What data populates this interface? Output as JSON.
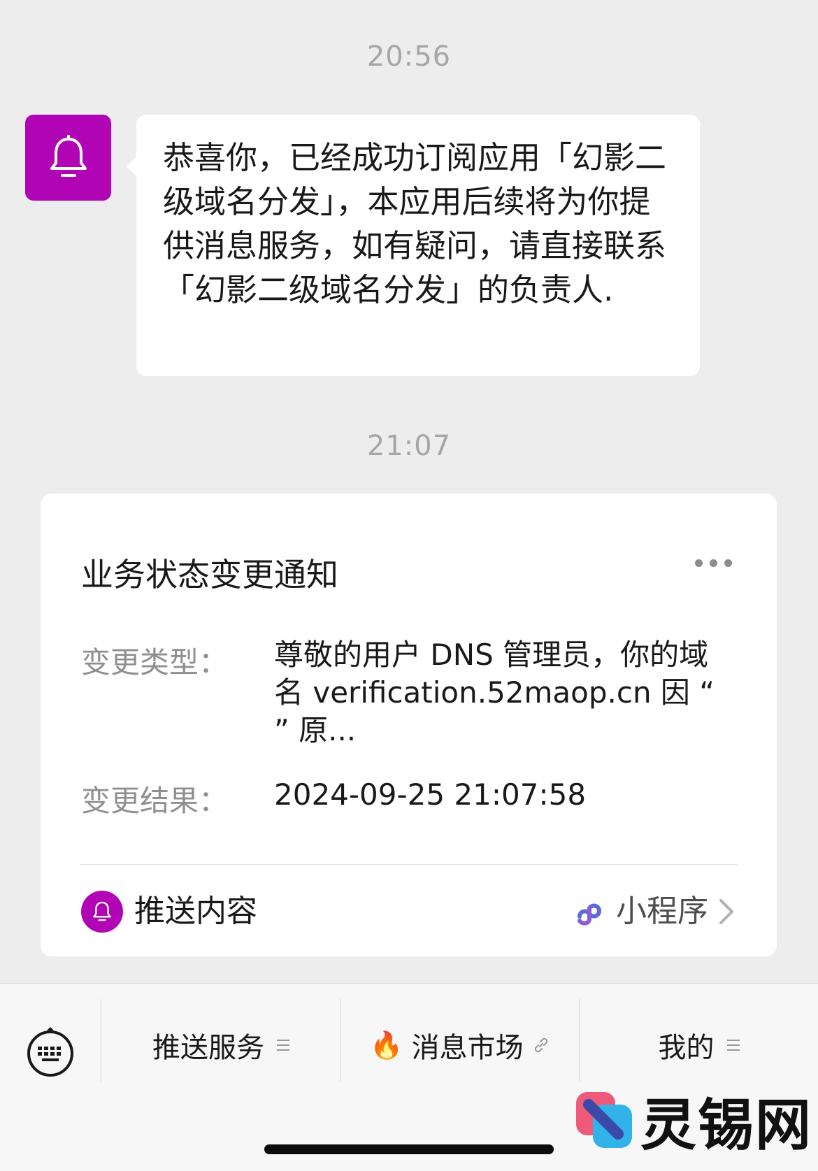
{
  "chat": {
    "timestamp1": "20:56",
    "message1": "恭喜你，已经成功订阅应用「幻影二级域名分发」，本应用后续将为你提供消息服务，如有疑问，请直接联系「幻影二级域名分发」的负责人.",
    "timestamp2": "21:07"
  },
  "card": {
    "title": "业务状态变更通知",
    "fields": [
      {
        "label": "变更类型：",
        "value": "尊敬的用户 DNS 管理员，你的域名 verification.52maop.cn 因 “ ” 原..."
      },
      {
        "label": "变更结果：",
        "value": "2024-09-25 21:07:58"
      }
    ],
    "footer_label": "推送内容",
    "miniprogram_label": "小程序"
  },
  "tabbar": {
    "tabs": [
      {
        "label": "推送服务"
      },
      {
        "label": "消息市场",
        "emoji": "🔥"
      },
      {
        "label": "我的"
      }
    ]
  },
  "watermark": {
    "text": "灵锡网"
  },
  "colors": {
    "accent": "#b104b5",
    "background": "#ededed",
    "miniprogram_icon": "#5b6cd6"
  },
  "icons": [
    "bell-icon",
    "more-icon",
    "miniprogram-icon",
    "chevron-right-icon",
    "keyboard-icon",
    "menu-icon",
    "link-icon",
    "fire-icon"
  ]
}
